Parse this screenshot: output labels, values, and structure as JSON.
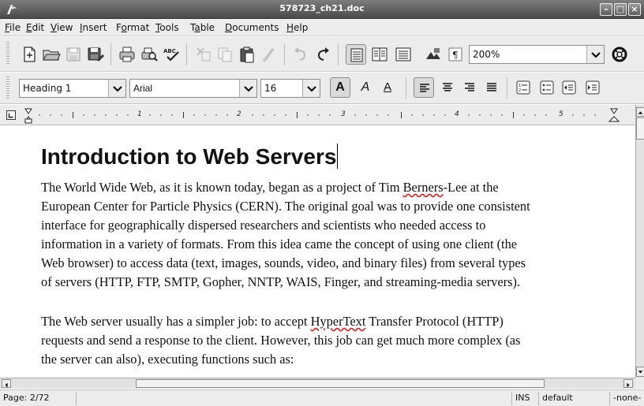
{
  "window": {
    "title": "578723_ch21.doc"
  },
  "menu": [
    "File",
    "Edit",
    "View",
    "Insert",
    "Format",
    "Tools",
    "Table",
    "Documents",
    "Help"
  ],
  "menu_mnemonics": [
    "F",
    "E",
    "V",
    "I",
    "o",
    "T",
    "a",
    "D",
    "H"
  ],
  "toolbar": {
    "zoom": "200%"
  },
  "format_bar": {
    "style": "Heading 1",
    "font": "Arial",
    "size": "16",
    "bold_glyph": "A",
    "italic_glyph": "A",
    "underline_glyph": "A"
  },
  "ruler": {
    "numbers": [
      "1",
      "2",
      "3",
      "4",
      "5"
    ]
  },
  "document": {
    "heading": "Introduction to Web Servers",
    "para1": [
      "The World Wide Web, as it is known today, began as a project of Tim ",
      "Berners",
      "-Lee at the",
      "European Center for Particle Physics (CERN). The original goal was to provide one consistent",
      "interface for geographically dispersed researchers and scientists who needed access to",
      "information in a variety of formats. From this idea came the concept of using one client (the",
      "Web browser) to access data (text, images, sounds, video, and binary files) from several types",
      "of servers (HTTP, FTP, SMTP, Gopher, NNTP, WAIS, Finger, and streaming-media servers)."
    ],
    "para2": [
      "The Web server usually has a simpler job: to accept ",
      "HyperText",
      " Transfer Protocol (HTTP)",
      "requests and send a response to the client. However, this job can get much more complex (as",
      "the server can also), executing functions such as:"
    ]
  },
  "status": {
    "page": "Page: 2/72",
    "mode": "INS",
    "language": "default",
    "selection": "-none-"
  },
  "colors": {
    "titlebar": "#5a5a5a",
    "toolbar_bg": "#ececec",
    "spell_error": "#dd2222"
  }
}
